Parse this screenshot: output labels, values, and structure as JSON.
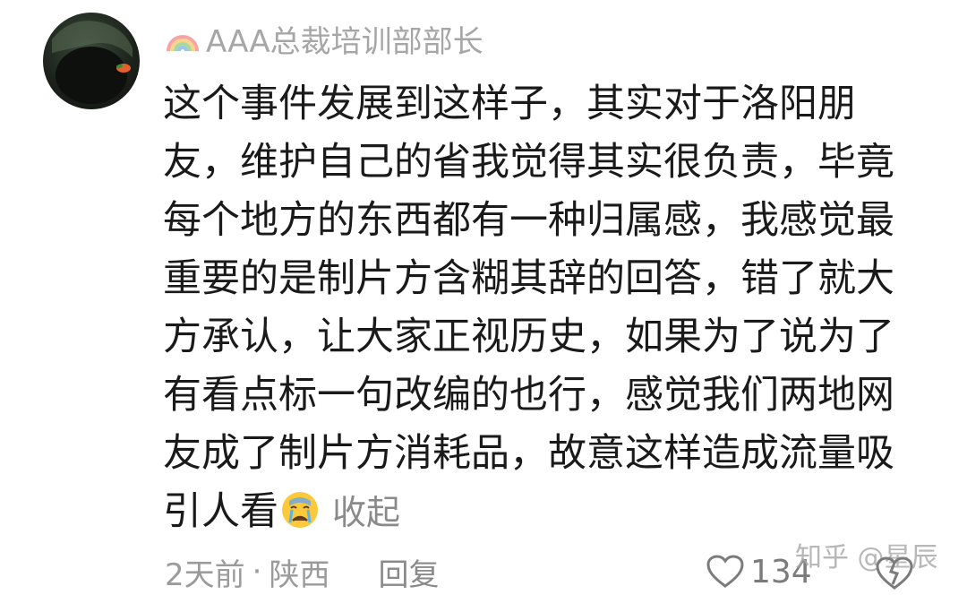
{
  "comment": {
    "username": "AAA总裁培训部部长",
    "badge_icon": "rainbow-icon",
    "body": "这个事件发展到这样子，其实对于洛阳朋友，维护自己的省我觉得其实很负责，毕竟每个地方的东西都有一种归属感，我感觉最重要的是制片方含糊其辞的回答，错了就大方承认，让大家正视历史，如果为了说为了有看点标一句改编的也行，感觉我们两地网友成了制片方消耗品，故意这样造成流量吸引人看",
    "emoji_icon": "crying-face-icon",
    "collapse_label": "收起",
    "time": "2天前",
    "separator": "·",
    "location": "陕西",
    "reply_label": "回复",
    "like_count": "134"
  },
  "watermark": "知乎 @星辰",
  "colors": {
    "text": "#1a1a1a",
    "muted": "#9b9b9b",
    "background": "#ffffff"
  }
}
